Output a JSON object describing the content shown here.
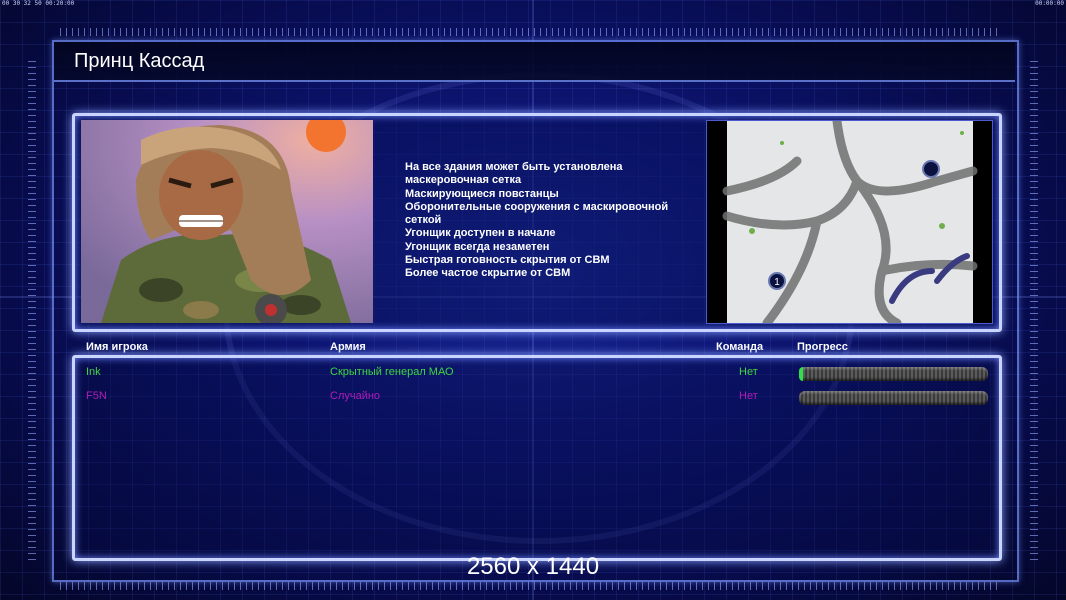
{
  "topbar": {
    "clock_left": "00 30 32 50  00:20:00",
    "clock_right": "00:00:00"
  },
  "title": "Принц Кассад",
  "features": [
    "На все здания может быть установлена",
    " маскеровочная сетка",
    "Маскирующиеся повстанцы",
    "Оборонительные сооружения с маскировочной",
    " сеткой",
    "Угонщик доступен в начале",
    "Угонщик всегда незаметен",
    "Быстрая готовность скрытия от СВМ",
    "Более частое скрытие от СВМ"
  ],
  "minimap": {
    "start_marker": "1"
  },
  "table": {
    "headers": {
      "player": "Имя игрока",
      "army": "Армия",
      "team": "Команда",
      "progress": "Прогресс"
    },
    "rows": [
      {
        "name": "Ink",
        "army": "Скрытный генерал МАО",
        "team": "Нет",
        "progress": 0.02,
        "color": "#3fd63f"
      },
      {
        "name": "F5N",
        "army": "Случайно",
        "team": "Нет",
        "progress": 0.0,
        "color": "#b21bb8"
      }
    ]
  },
  "resolution_label": "2560 x 1440",
  "colors": {
    "accent": "#c9d4ff",
    "progress_fill": "#2fe04a",
    "background": "#0c1470"
  }
}
